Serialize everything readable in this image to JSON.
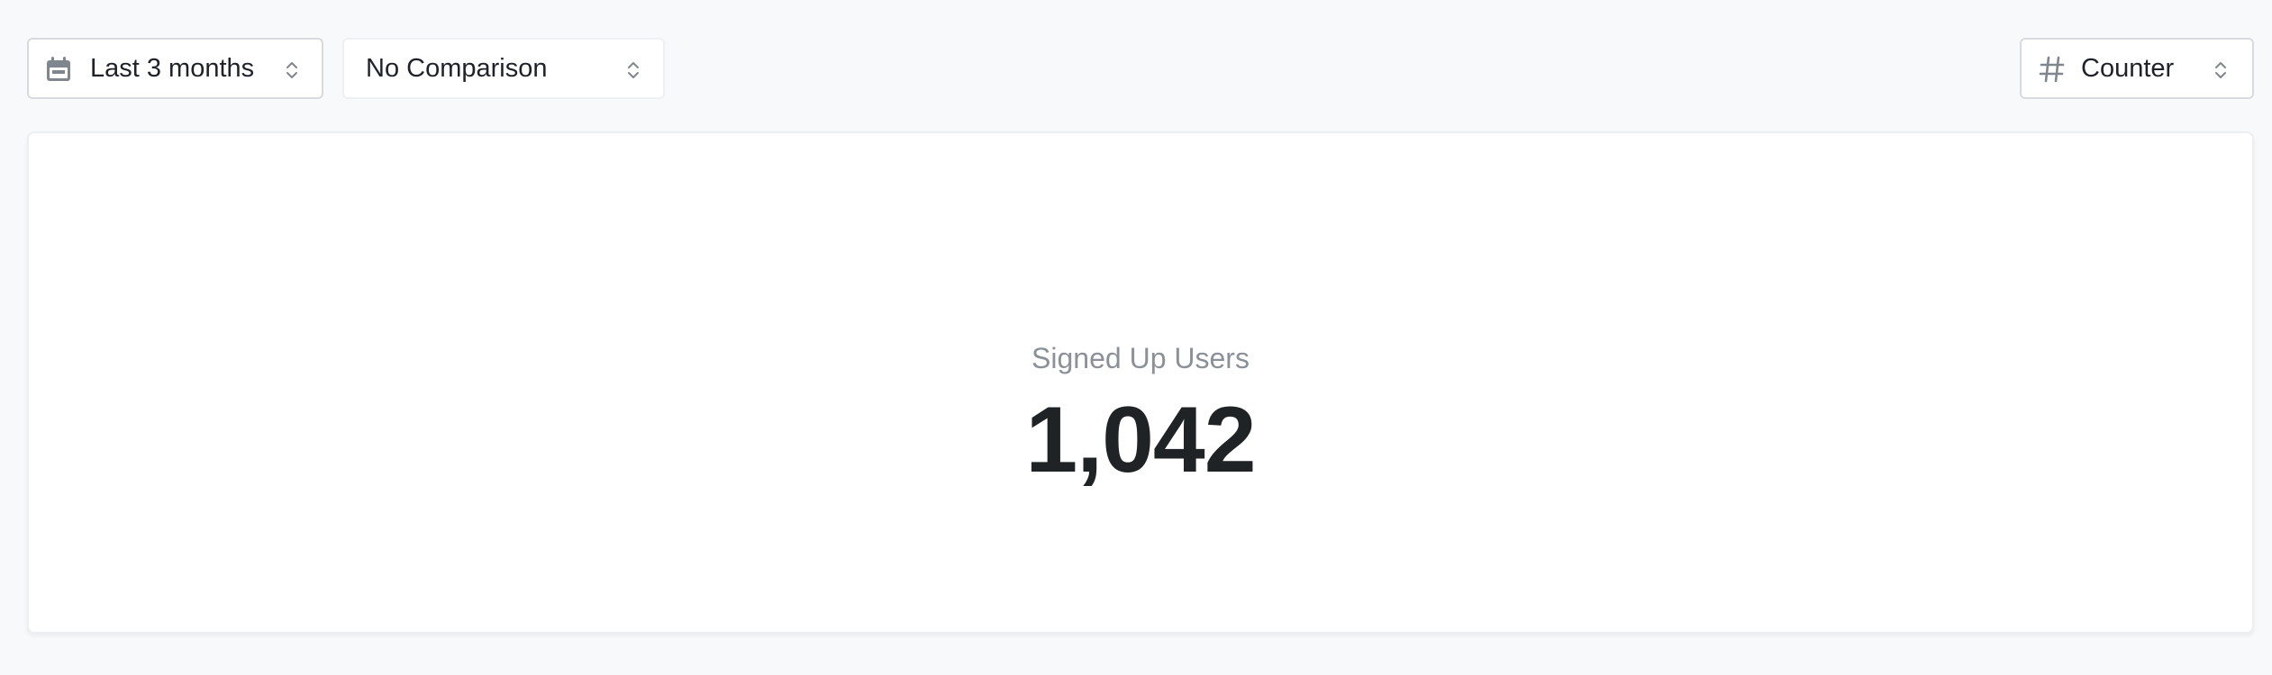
{
  "toolbar": {
    "date_range": {
      "label": "Last 3 months",
      "icon": "calendar-icon"
    },
    "comparison": {
      "label": "No Comparison"
    },
    "visualization": {
      "label": "Counter",
      "icon": "hash-icon"
    }
  },
  "metric": {
    "label": "Signed Up Users",
    "value": "1,042"
  },
  "colors": {
    "background": "#f8f9fb",
    "card": "#ffffff",
    "text_primary": "#202326",
    "text_muted": "#8b9199",
    "icon": "#80868e",
    "border": "#d7dbe0"
  }
}
